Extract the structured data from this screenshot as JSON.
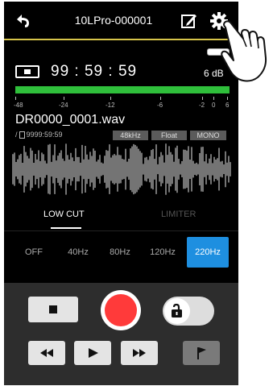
{
  "header": {
    "title": "10LPro-000001"
  },
  "status": {
    "time": "99 : 59 : 59",
    "level": "6 dB"
  },
  "meter_scale": [
    "-48",
    "-24",
    "-12",
    "-6",
    "-2",
    "0",
    "6"
  ],
  "file": {
    "name": "DR0000_0001.wav",
    "remaining": "9999:59:59",
    "sample_rate": "48kHz",
    "format": "Float",
    "channels": "MONO"
  },
  "tabs": {
    "low_cut": "LOW CUT",
    "limiter": "LIMITER"
  },
  "filters": [
    "OFF",
    "40Hz",
    "80Hz",
    "120Hz",
    "220Hz"
  ],
  "filter_selected": "220Hz",
  "colors": {
    "accent_line": "#d6c44a",
    "meter": "#2fbf3b",
    "selected": "#1e8fe0",
    "record": "#ff3a3a"
  }
}
